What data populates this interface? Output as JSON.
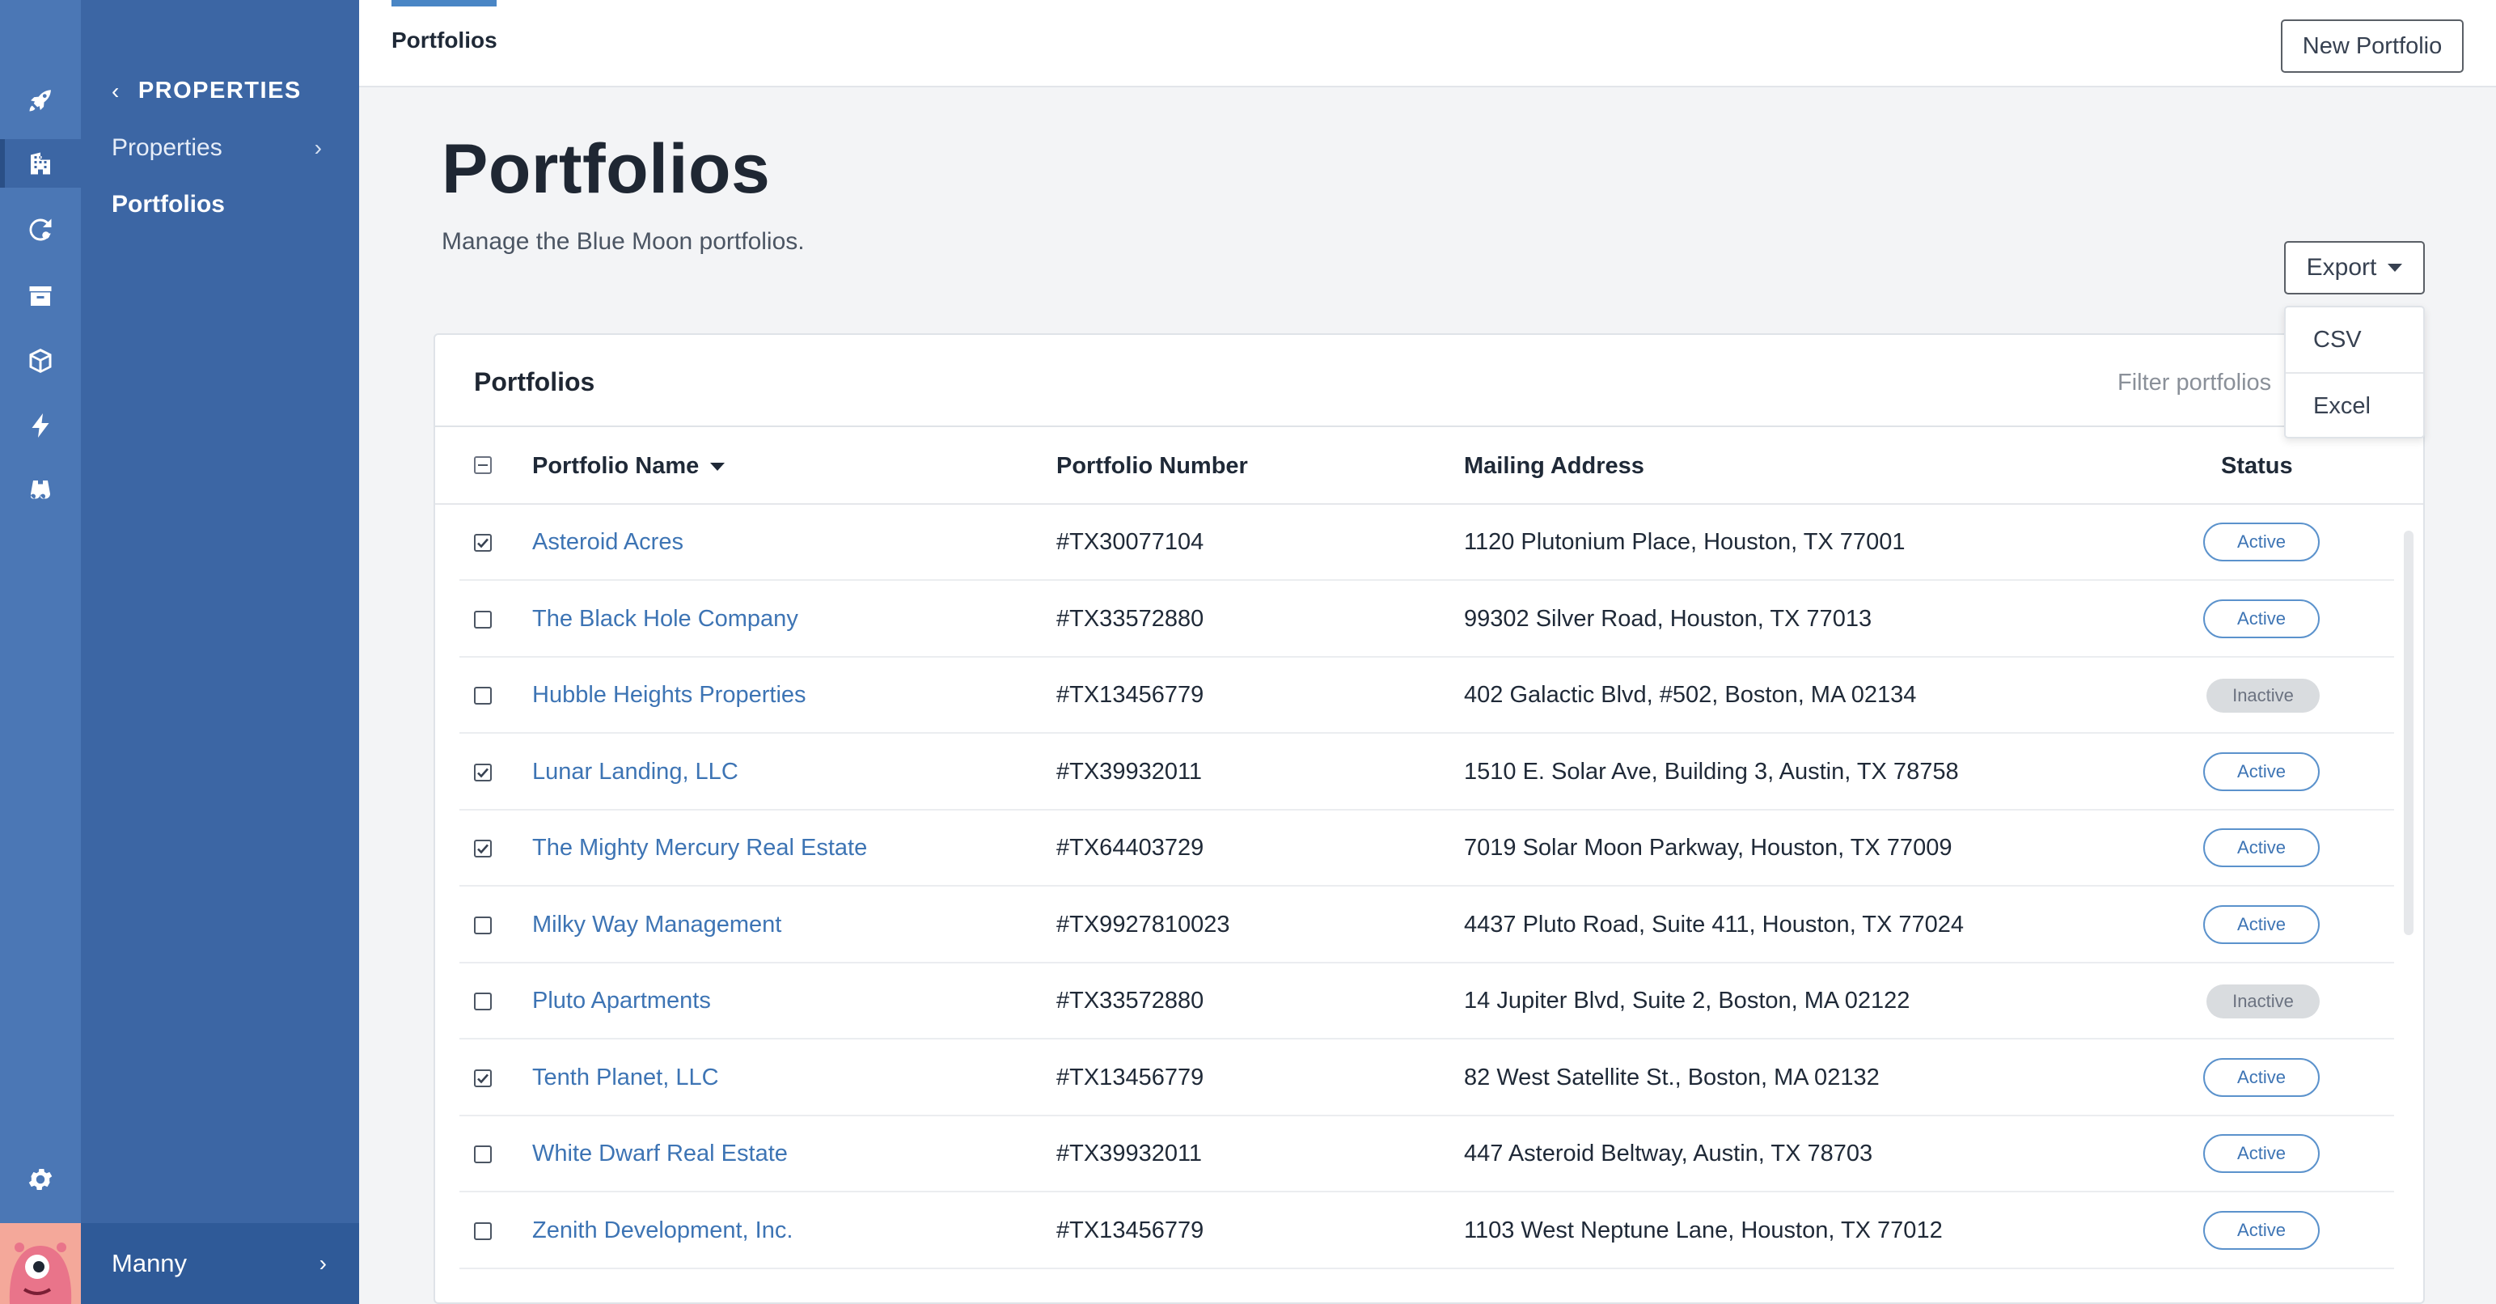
{
  "rail": {
    "icons": [
      "rocket-icon",
      "building-icon",
      "refresh-icon",
      "archive-icon",
      "box-icon",
      "bolt-icon",
      "binoculars-icon"
    ],
    "settings_icon": "gear-icon"
  },
  "sidenav": {
    "section_title": "PROPERTIES",
    "items": [
      {
        "label": "Properties",
        "has_chevron": true
      },
      {
        "label": "Portfolios",
        "active": true
      }
    ],
    "user": {
      "name": "Manny"
    }
  },
  "topbar": {
    "tab_label": "Portfolios",
    "new_button": "New Portfolio"
  },
  "page": {
    "title": "Portfolios",
    "subtitle": "Manage the Blue Moon portfolios."
  },
  "export": {
    "label": "Export",
    "options": [
      "CSV",
      "Excel"
    ]
  },
  "card": {
    "title": "Portfolios",
    "filter_placeholder": "Filter portfolios"
  },
  "table": {
    "columns": {
      "name": "Portfolio Name",
      "number": "Portfolio Number",
      "address": "Mailing Address",
      "status": "Status"
    },
    "rows": [
      {
        "checked": true,
        "name": "Asteroid Acres",
        "number": "#TX30077104",
        "address": "1120 Plutonium Place, Houston, TX 77001",
        "status": "Active"
      },
      {
        "checked": false,
        "name": "The Black Hole Company",
        "number": "#TX33572880",
        "address": "99302 Silver Road, Houston, TX 77013",
        "status": "Active"
      },
      {
        "checked": false,
        "name": "Hubble Heights Properties",
        "number": "#TX13456779",
        "address": "402 Galactic Blvd, #502, Boston, MA 02134",
        "status": "Inactive"
      },
      {
        "checked": true,
        "name": "Lunar Landing, LLC",
        "number": "#TX39932011",
        "address": "1510 E. Solar Ave, Building 3, Austin, TX 78758",
        "status": "Active"
      },
      {
        "checked": true,
        "name": "The Mighty Mercury Real Estate",
        "number": "#TX64403729",
        "address": "7019 Solar Moon Parkway, Houston, TX 77009",
        "status": "Active"
      },
      {
        "checked": false,
        "name": "Milky Way Management",
        "number": "#TX9927810023",
        "address": "4437 Pluto Road, Suite 411, Houston, TX 77024",
        "status": "Active"
      },
      {
        "checked": false,
        "name": "Pluto Apartments",
        "number": "#TX33572880",
        "address": "14 Jupiter Blvd, Suite 2, Boston, MA 02122",
        "status": "Inactive"
      },
      {
        "checked": true,
        "name": "Tenth Planet, LLC",
        "number": "#TX13456779",
        "address": "82 West Satellite St., Boston, MA 02132",
        "status": "Active"
      },
      {
        "checked": false,
        "name": "White Dwarf Real Estate",
        "number": "#TX39932011",
        "address": "447 Asteroid Beltway, Austin, TX 78703",
        "status": "Active"
      },
      {
        "checked": false,
        "name": "Zenith Development, Inc.",
        "number": "#TX13456779",
        "address": "1103 West Neptune Lane, Houston, TX 77012",
        "status": "Active"
      }
    ]
  },
  "colors": {
    "rail": "#4b77b5",
    "sidenav": "#3c66a4",
    "link": "#3d74b4",
    "accent": "#4a86c5"
  }
}
